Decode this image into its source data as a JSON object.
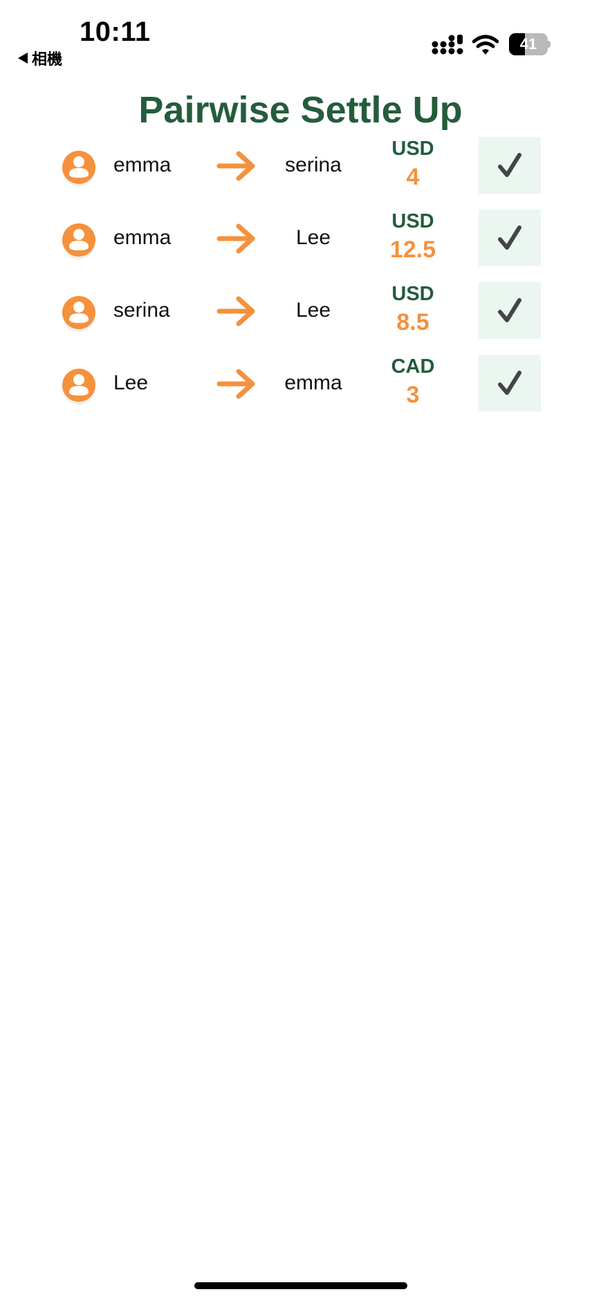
{
  "status_bar": {
    "time": "10:11",
    "back_label": "相機",
    "battery_level": "41"
  },
  "title": "Pairwise Settle Up",
  "colors": {
    "title_green": "#245c3c",
    "accent_orange": "#f5913c",
    "button_bg": "#ebf6f0",
    "check_dark": "#444444"
  },
  "icons": {
    "avatar": "user-circle-icon",
    "direction": "arrow-right-icon",
    "settle": "checkmark-icon"
  },
  "settlements": [
    {
      "from": "emma",
      "to": "serina",
      "currency": "USD",
      "amount": "4"
    },
    {
      "from": "emma",
      "to": "Lee",
      "currency": "USD",
      "amount": "12.5"
    },
    {
      "from": "serina",
      "to": "Lee",
      "currency": "USD",
      "amount": "8.5"
    },
    {
      "from": "Lee",
      "to": "emma",
      "currency": "CAD",
      "amount": "3"
    }
  ]
}
